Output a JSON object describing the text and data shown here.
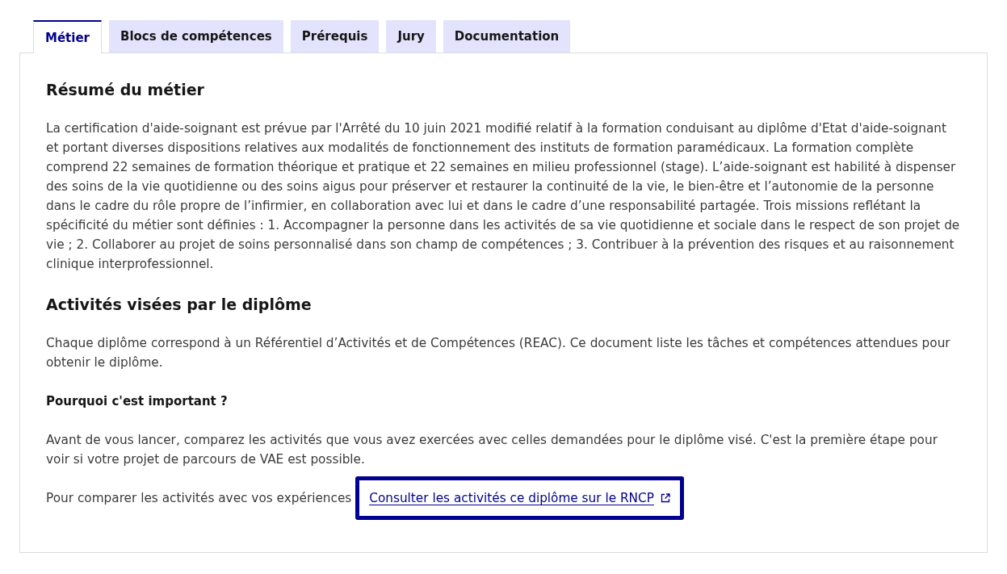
{
  "tabs": [
    {
      "label": "Métier",
      "selected": true
    },
    {
      "label": "Blocs de compétences",
      "selected": false
    },
    {
      "label": "Prérequis",
      "selected": false
    },
    {
      "label": "Jury",
      "selected": false
    },
    {
      "label": "Documentation",
      "selected": false
    }
  ],
  "panel": {
    "sections": [
      {
        "kind": "heading",
        "text": "Résumé du métier"
      },
      {
        "kind": "paragraph",
        "text": "La certification d'aide-soignant est prévue par l'Arrêté du 10 juin 2021 modifié relatif à la formation conduisant au diplôme d'Etat d'aide-soignant et portant diverses dispositions relatives aux modalités de fonctionnement des instituts de formation paramédicaux. La formation complète comprend 22 semaines de formation théorique et pratique et 22 semaines en milieu professionnel (stage). L’aide-soignant est habilité à dispenser des soins de la vie quotidienne ou des soins aigus pour préserver et restaurer la continuité de la vie, le bien-être et l’autonomie de la personne dans le cadre du rôle propre de l’infirmier, en collaboration avec lui et dans le cadre d’une responsabilité partagée. Trois missions reflétant la spécificité du métier sont définies : 1. Accompagner la personne dans les activités de sa vie quotidienne et sociale dans le respect de son projet de vie ; 2. Collaborer au projet de soins personnalisé dans son champ de compétences ; 3. Contribuer à la prévention des risques et au raisonnement clinique interprofessionnel."
      },
      {
        "kind": "heading",
        "text": "Activités visées par le diplôme"
      },
      {
        "kind": "paragraph",
        "text": "Chaque diplôme correspond à un Référentiel d’Activités et de Compétences (REAC). Ce document liste les tâches et compétences attendues pour obtenir le diplôme."
      },
      {
        "kind": "subheading",
        "text": "Pourquoi c'est important ?"
      },
      {
        "kind": "paragraph",
        "text": "Avant de vous lancer, comparez les activités que vous avez exercées avec celles demandées pour le diplôme visé. C'est la première étape pour voir si votre projet de parcours de VAE est possible."
      },
      {
        "kind": "link_paragraph",
        "text": "Pour comparer les activités avec vos expériences",
        "link": {
          "label": "Consulter les activités ce diplôme sur le RNCP",
          "focused": true
        }
      }
    ]
  }
}
